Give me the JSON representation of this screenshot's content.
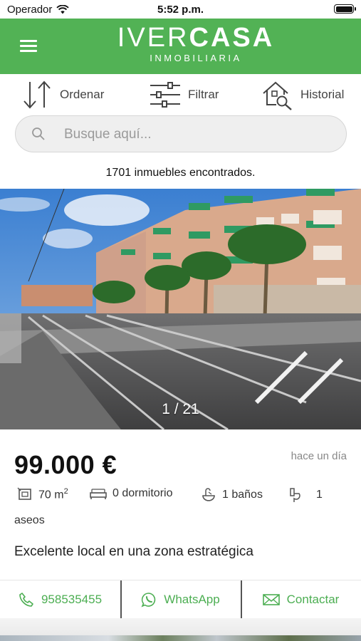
{
  "status_bar": {
    "carrier": "Operador",
    "time": "5:52 p.m."
  },
  "header": {
    "logo_main_light": "IVER",
    "logo_main_bold": "CASA",
    "logo_sub": "INMOBILIARIA"
  },
  "colors": {
    "brand_green": "#52b255",
    "action_green": "#4cae52"
  },
  "toolbar": {
    "sort_label": "Ordenar",
    "filter_label": "Filtrar",
    "history_label": "Historial"
  },
  "search": {
    "placeholder": "Busque aquí..."
  },
  "results_text": "1701 inmuebles encontrados.",
  "listing": {
    "photo_counter": "1 / 21",
    "price": "99.000 €",
    "date": "hace un día",
    "area_value": "70 m",
    "area_unit_sup": "2",
    "rooms": "0 dormitorio",
    "baths": "1 baños",
    "toilets_num": "1",
    "toilets_word": "aseos",
    "description": "Excelente local en una zona estratégica"
  },
  "contact": {
    "phone": "958535455",
    "whatsapp": "WhatsApp",
    "contact": "Contactar"
  },
  "icons": [
    "wifi-icon",
    "battery-icon",
    "menu-icon",
    "sort-icon",
    "filter-icon",
    "history-house-icon",
    "search-icon",
    "area-icon",
    "bed-icon",
    "bath-icon",
    "toilet-icon",
    "phone-icon",
    "whatsapp-icon",
    "mail-icon"
  ]
}
